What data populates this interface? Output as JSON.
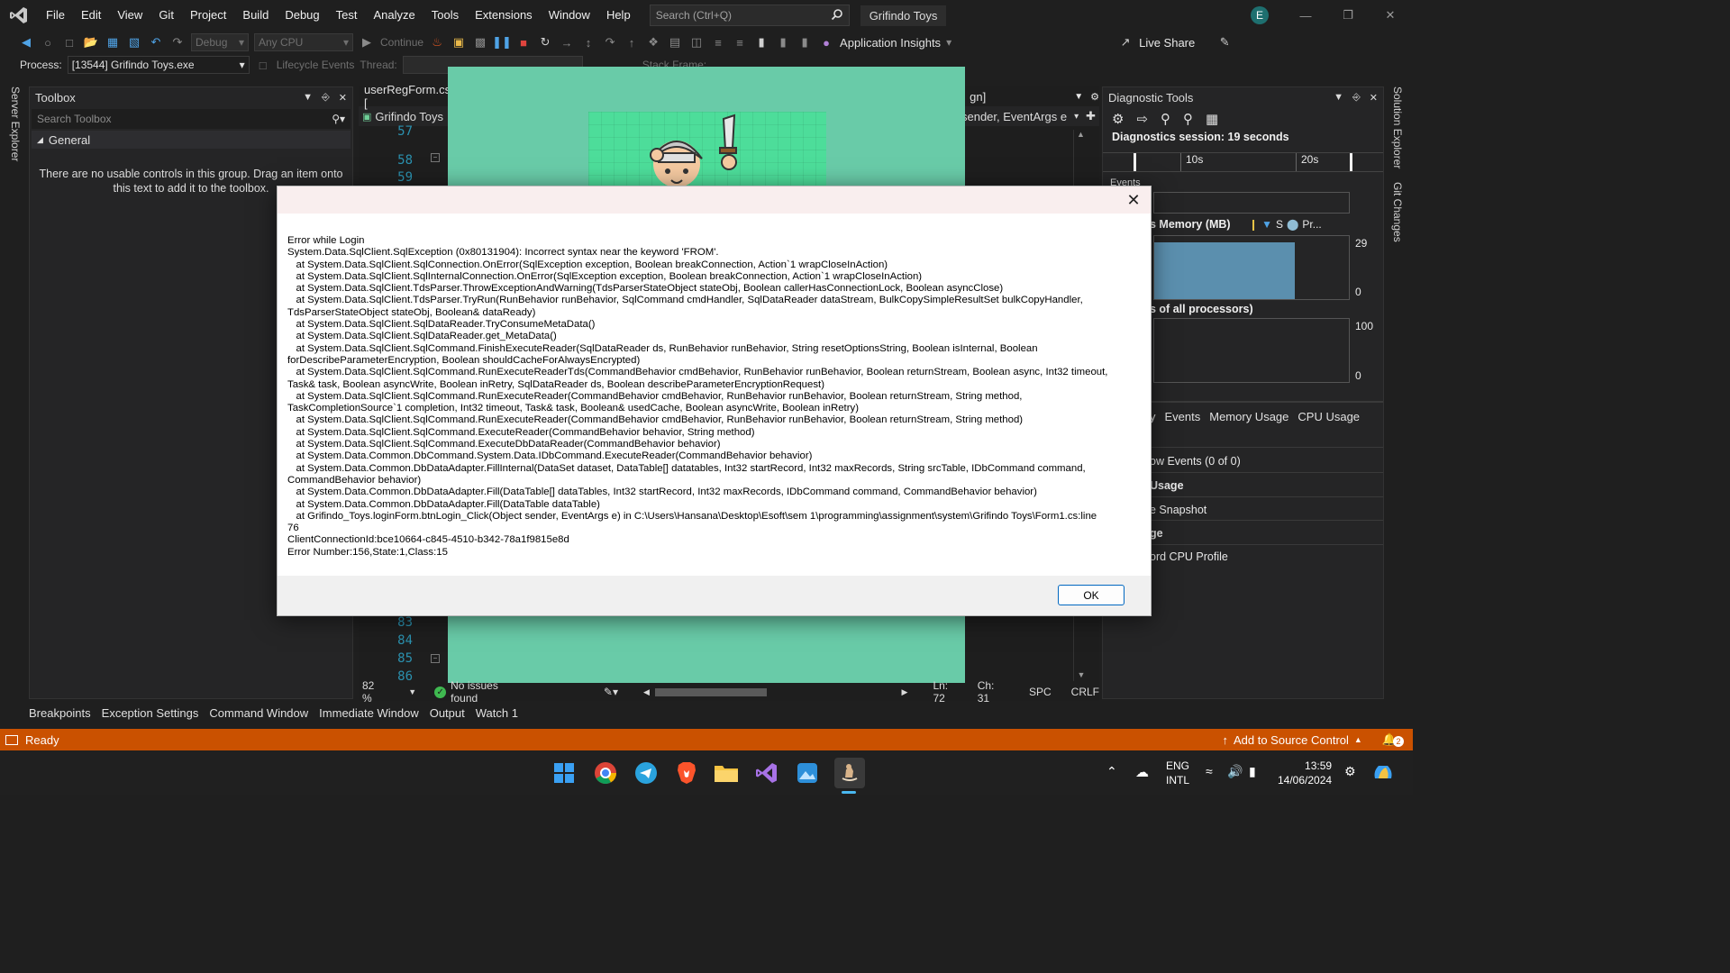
{
  "title_bar": {
    "menu": [
      "File",
      "Edit",
      "View",
      "Git",
      "Project",
      "Build",
      "Debug",
      "Test",
      "Analyze",
      "Tools",
      "Extensions",
      "Window",
      "Help"
    ],
    "search_placeholder": "Search (Ctrl+Q)",
    "solution_name": "Grifindo Toys",
    "avatar_initial": "E"
  },
  "toolbar": {
    "config": "Debug",
    "platform": "Any CPU",
    "continue_label": "Continue",
    "app_insights": "Application Insights",
    "live_share": "Live Share"
  },
  "process_row": {
    "process_label": "Process:",
    "process_value": "[13544] Grifindo Toys.exe",
    "lifecycle": "Lifecycle Events",
    "thread_label": "Thread:",
    "stack_frame": "Stack Frame:"
  },
  "side_rails": {
    "left": "Server Explorer",
    "right": [
      "Solution Explorer",
      "Git Changes"
    ]
  },
  "toolbox": {
    "title": "Toolbox",
    "search_placeholder": "Search Toolbox",
    "group": "General",
    "empty_text": "There are no usable controls in this group. Drag an item onto this text to add it to the toolbox."
  },
  "editor": {
    "tab": "userRegForm.cs [",
    "tab_right": "gn]",
    "nav_left": "Grifindo Toys",
    "nav_right": "sender, EventArgs e",
    "line_numbers_top": [
      "57",
      "58",
      "59"
    ],
    "line_numbers_bottom": [
      "83",
      "84",
      "85",
      "86"
    ],
    "zoom": "82 %",
    "issues": "No issues found",
    "ln": "Ln: 72",
    "ch": "Ch: 31",
    "spc": "SPC",
    "crlf": "CRLF"
  },
  "diagnostics": {
    "title": "Diagnostic Tools",
    "session": "Diagnostics session: 19 seconds",
    "tick_10s": "10s",
    "tick_20s": "20s",
    "events_label": "Events",
    "memory_label": "s Memory (MB)",
    "memory_legend_s": "S",
    "memory_legend_pr": "Pr...",
    "memory_max": "29",
    "memory_min": "0",
    "cpu_label": "s of all processors)",
    "cpu_max": "100",
    "cpu_min": "0",
    "tabs": [
      "y",
      "Events",
      "Memory Usage",
      "CPU Usage"
    ],
    "rows": [
      "ow Events (0 of 0)",
      " Usage",
      "e Snapshot",
      "ge",
      "ord CPU Profile"
    ],
    "memory_fill_fraction": 0.9,
    "memory_color": "#5b8fae"
  },
  "bottom_tabs": [
    "Breakpoints",
    "Exception Settings",
    "Command Window",
    "Immediate Window",
    "Output",
    "Watch 1"
  ],
  "status_bar": {
    "ready": "Ready",
    "source_control": "Add to Source Control",
    "notification_count": "2",
    "color": "#ca5100"
  },
  "taskbar": {
    "language": "ENG",
    "layout": "INTL",
    "time": "13:59",
    "date": "14/06/2024"
  },
  "dialog": {
    "lines": [
      "Error while Login",
      "System.Data.SqlClient.SqlException (0x80131904): Incorrect syntax near the keyword 'FROM'.",
      "   at System.Data.SqlClient.SqlConnection.OnError(SqlException exception, Boolean breakConnection, Action`1 wrapCloseInAction)",
      "   at System.Data.SqlClient.SqlInternalConnection.OnError(SqlException exception, Boolean breakConnection, Action`1 wrapCloseInAction)",
      "   at System.Data.SqlClient.TdsParser.ThrowExceptionAndWarning(TdsParserStateObject stateObj, Boolean callerHasConnectionLock, Boolean asyncClose)",
      "   at System.Data.SqlClient.TdsParser.TryRun(RunBehavior runBehavior, SqlCommand cmdHandler, SqlDataReader dataStream, BulkCopySimpleResultSet bulkCopyHandler,",
      "TdsParserStateObject stateObj, Boolean& dataReady)",
      "   at System.Data.SqlClient.SqlDataReader.TryConsumeMetaData()",
      "   at System.Data.SqlClient.SqlDataReader.get_MetaData()",
      "   at System.Data.SqlClient.SqlCommand.FinishExecuteReader(SqlDataReader ds, RunBehavior runBehavior, String resetOptionsString, Boolean isInternal, Boolean",
      "forDescribeParameterEncryption, Boolean shouldCacheForAlwaysEncrypted)",
      "   at System.Data.SqlClient.SqlCommand.RunExecuteReaderTds(CommandBehavior cmdBehavior, RunBehavior runBehavior, Boolean returnStream, Boolean async, Int32 timeout,",
      "Task& task, Boolean asyncWrite, Boolean inRetry, SqlDataReader ds, Boolean describeParameterEncryptionRequest)",
      "   at System.Data.SqlClient.SqlCommand.RunExecuteReader(CommandBehavior cmdBehavior, RunBehavior runBehavior, Boolean returnStream, String method,",
      "TaskCompletionSource`1 completion, Int32 timeout, Task& task, Boolean& usedCache, Boolean asyncWrite, Boolean inRetry)",
      "   at System.Data.SqlClient.SqlCommand.RunExecuteReader(CommandBehavior cmdBehavior, RunBehavior runBehavior, Boolean returnStream, String method)",
      "   at System.Data.SqlClient.SqlCommand.ExecuteReader(CommandBehavior behavior, String method)",
      "   at System.Data.SqlClient.SqlCommand.ExecuteDbDataReader(CommandBehavior behavior)",
      "   at System.Data.Common.DbCommand.System.Data.IDbCommand.ExecuteReader(CommandBehavior behavior)",
      "   at System.Data.Common.DbDataAdapter.FillInternal(DataSet dataset, DataTable[] datatables, Int32 startRecord, Int32 maxRecords, String srcTable, IDbCommand command,",
      "CommandBehavior behavior)",
      "   at System.Data.Common.DbDataAdapter.Fill(DataTable[] dataTables, Int32 startRecord, Int32 maxRecords, IDbCommand command, CommandBehavior behavior)",
      "   at System.Data.Common.DbDataAdapter.Fill(DataTable dataTable)",
      "   at Grifindo_Toys.loginForm.btnLogin_Click(Object sender, EventArgs e) in C:\\Users\\Hansana\\Desktop\\Esoft\\sem 1\\programming\\assignment\\system\\Grifindo Toys\\Form1.cs:line",
      "76",
      "ClientConnectionId:bce10664-c845-4510-b342-78a1f9815e8d",
      "Error Number:156,State:1,Class:15"
    ],
    "ok_label": "OK"
  }
}
